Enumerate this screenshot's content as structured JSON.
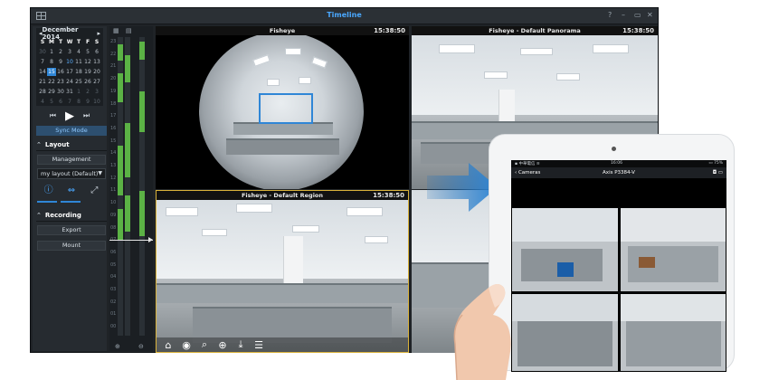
{
  "window": {
    "title": "Timeline",
    "controls": [
      "?",
      "–",
      "▭",
      "✕"
    ]
  },
  "calendar": {
    "month_label": "December 2014",
    "prev": "◂",
    "next": "▸",
    "weekdays": [
      "S",
      "M",
      "T",
      "W",
      "T",
      "F",
      "S"
    ],
    "days": [
      {
        "d": "30",
        "s": "muted"
      },
      {
        "d": "1",
        "s": ""
      },
      {
        "d": "2",
        "s": ""
      },
      {
        "d": "3",
        "s": ""
      },
      {
        "d": "4",
        "s": ""
      },
      {
        "d": "5",
        "s": ""
      },
      {
        "d": "6",
        "s": ""
      },
      {
        "d": "7",
        "s": ""
      },
      {
        "d": "8",
        "s": ""
      },
      {
        "d": "9",
        "s": ""
      },
      {
        "d": "10",
        "s": "mark"
      },
      {
        "d": "11",
        "s": ""
      },
      {
        "d": "12",
        "s": ""
      },
      {
        "d": "13",
        "s": ""
      },
      {
        "d": "14",
        "s": ""
      },
      {
        "d": "15",
        "s": "today"
      },
      {
        "d": "16",
        "s": ""
      },
      {
        "d": "17",
        "s": ""
      },
      {
        "d": "18",
        "s": ""
      },
      {
        "d": "19",
        "s": ""
      },
      {
        "d": "20",
        "s": ""
      },
      {
        "d": "21",
        "s": ""
      },
      {
        "d": "22",
        "s": ""
      },
      {
        "d": "23",
        "s": ""
      },
      {
        "d": "24",
        "s": ""
      },
      {
        "d": "25",
        "s": ""
      },
      {
        "d": "26",
        "s": ""
      },
      {
        "d": "27",
        "s": ""
      },
      {
        "d": "28",
        "s": ""
      },
      {
        "d": "29",
        "s": ""
      },
      {
        "d": "30",
        "s": ""
      },
      {
        "d": "31",
        "s": ""
      },
      {
        "d": "1",
        "s": "muted"
      },
      {
        "d": "2",
        "s": "muted"
      },
      {
        "d": "3",
        "s": "muted"
      },
      {
        "d": "4",
        "s": "muted"
      },
      {
        "d": "5",
        "s": "muted"
      },
      {
        "d": "6",
        "s": "muted"
      },
      {
        "d": "7",
        "s": "muted"
      },
      {
        "d": "8",
        "s": "muted"
      },
      {
        "d": "9",
        "s": "muted"
      },
      {
        "d": "10",
        "s": "muted"
      }
    ]
  },
  "playback": {
    "prev_icon": "⏮",
    "play_icon": "▶",
    "next_icon": "⏭",
    "sync_label": "Sync Mode"
  },
  "layout_section": {
    "header": "Layout",
    "management_label": "Management",
    "select_value": "my layout (Default)",
    "info_icon": "ⓘ",
    "fit_icon": "⇔",
    "expand_icon": "⤢"
  },
  "recording_section": {
    "header": "Recording",
    "export_label": "Export",
    "mount_label": "Mount"
  },
  "timeline": {
    "hours": [
      "23",
      "22",
      "21",
      "20",
      "19",
      "18",
      "17",
      "16",
      "15",
      "14",
      "13",
      "12",
      "11",
      "10",
      "09",
      "08",
      "07",
      "06",
      "05",
      "04",
      "03",
      "02",
      "01",
      "00"
    ]
  },
  "tiles": {
    "top_left": {
      "title": "Fisheye",
      "time": "15:38:50"
    },
    "top_right": {
      "title": "Fisheye - Default Panorama",
      "time": "15:38:50"
    },
    "bottom_left": {
      "title": "Fisheye - Default Region",
      "time": "15:38:50"
    }
  },
  "toolbar_icons": [
    "⌂",
    "◉",
    "⌕",
    "⊕",
    "⤓",
    "☰"
  ],
  "tablet": {
    "status_left": "▪ 中華電信 ≋",
    "status_time": "16:06",
    "status_right": "▭ 75%",
    "back_label": "Cameras",
    "camera_name": "Axis P3384-V",
    "nav_icons": "◘ ▭"
  },
  "colors": {
    "accent": "#2f86d6",
    "title_blue": "#4aa8ff",
    "recording_green": "#5bb245",
    "active_tile_border": "#d9b23a"
  }
}
